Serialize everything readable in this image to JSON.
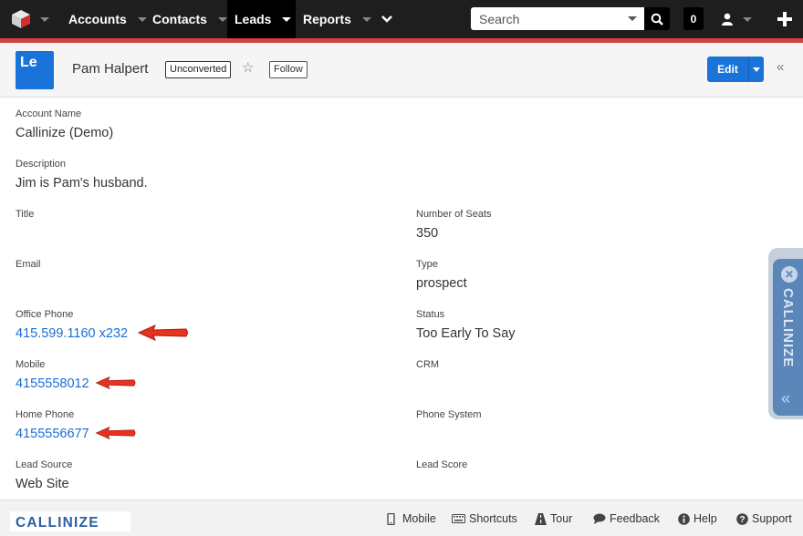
{
  "nav": {
    "tabs": [
      {
        "label": "Accounts"
      },
      {
        "label": "Contacts"
      },
      {
        "label": "Leads"
      },
      {
        "label": "Reports"
      }
    ],
    "search_placeholder": "Search",
    "notification_count": "0"
  },
  "record": {
    "module_abbr": "Le",
    "name": "Pam Halpert",
    "status": "Unconverted",
    "follow_label": "Follow",
    "edit_label": "Edit"
  },
  "fields": {
    "account_name": {
      "label": "Account Name",
      "value": "Callinize (Demo)"
    },
    "description": {
      "label": "Description",
      "value": "Jim is Pam's husband."
    },
    "title": {
      "label": "Title",
      "value": ""
    },
    "number_of_seats": {
      "label": "Number of Seats",
      "value": "350"
    },
    "email": {
      "label": "Email",
      "value": ""
    },
    "type": {
      "label": "Type",
      "value": "prospect"
    },
    "office_phone": {
      "label": "Office Phone",
      "value": "415.599.1160 x232"
    },
    "status": {
      "label": "Status",
      "value": "Too Early To Say"
    },
    "mobile": {
      "label": "Mobile",
      "value": "4155558012"
    },
    "crm": {
      "label": "CRM",
      "value": ""
    },
    "home_phone": {
      "label": "Home Phone",
      "value": "4155556677"
    },
    "phone_system": {
      "label": "Phone System",
      "value": ""
    },
    "lead_source": {
      "label": "Lead Source",
      "value": "Web Site"
    },
    "lead_score": {
      "label": "Lead Score",
      "value": ""
    }
  },
  "callinize_tab": {
    "label": "CALLINIZE"
  },
  "footer": {
    "brand": "CALLINIZE",
    "links": [
      {
        "label": "Mobile",
        "icon": "mobile-icon"
      },
      {
        "label": "Shortcuts",
        "icon": "keyboard-icon"
      },
      {
        "label": "Tour",
        "icon": "road-icon"
      },
      {
        "label": "Feedback",
        "icon": "comment-icon"
      },
      {
        "label": "Help",
        "icon": "info-icon"
      },
      {
        "label": "Support",
        "icon": "question-icon"
      }
    ]
  },
  "colors": {
    "nav_bg": "#1e1e1e",
    "accent_red": "#d64040",
    "primary_blue": "#1a73d9",
    "link_blue": "#1a6ed4",
    "arrow_red": "#e8321e",
    "callinize_blue": "#5b86ba"
  }
}
